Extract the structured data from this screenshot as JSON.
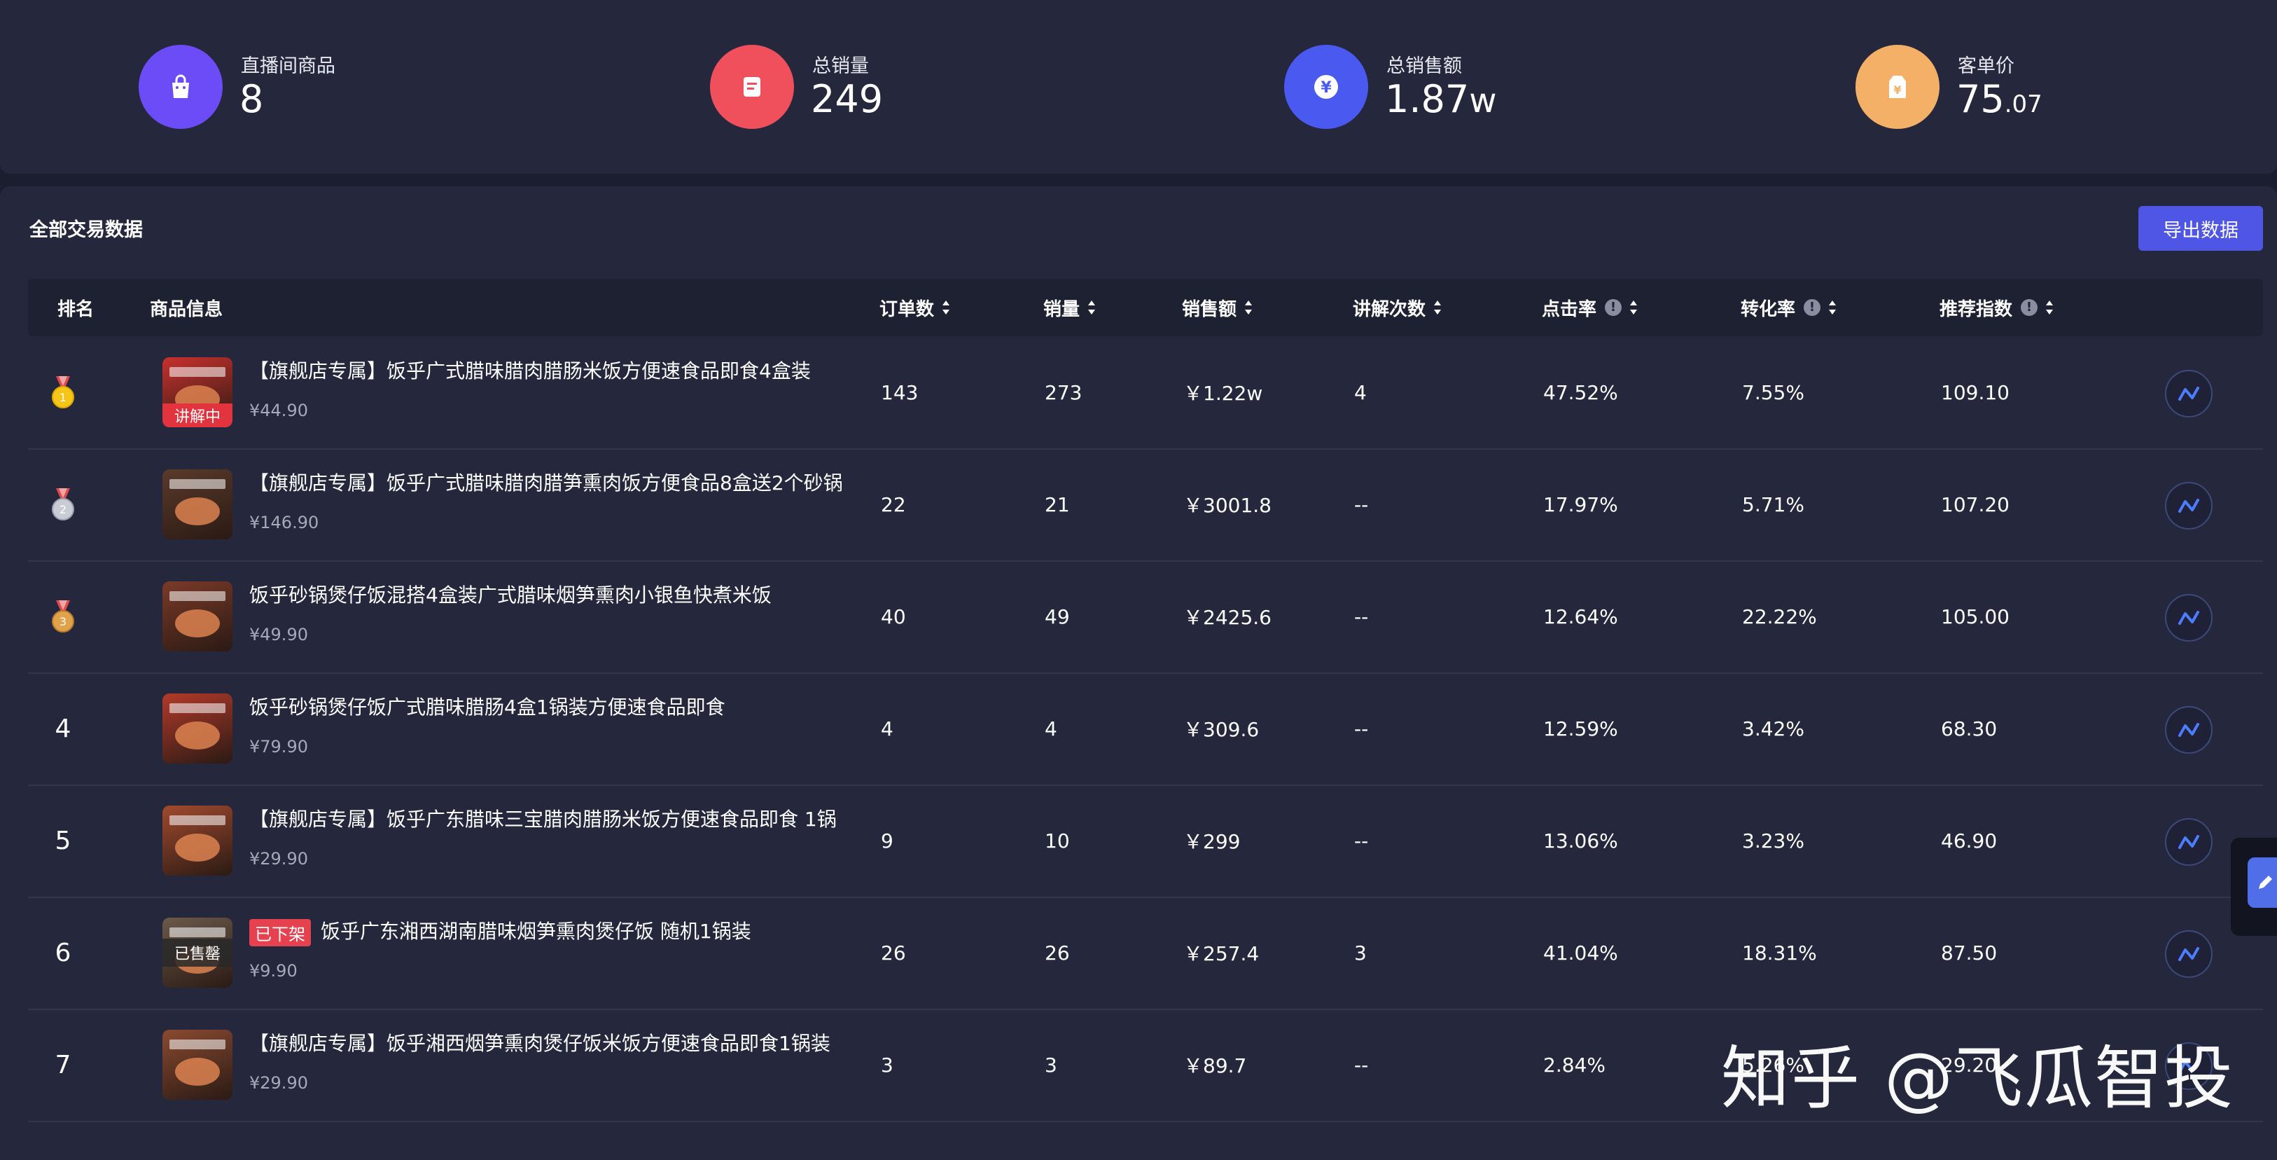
{
  "stats": [
    {
      "label": "直播间商品",
      "value": "8",
      "dec": "",
      "unit": "",
      "color": "#6b4cf6",
      "icon": "shopping-bag-icon"
    },
    {
      "label": "总销量",
      "value": "249",
      "dec": "",
      "unit": "",
      "color": "#f0505b",
      "icon": "receipt-icon"
    },
    {
      "label": "总销售额",
      "value": "1.87",
      "dec": "",
      "unit": "w",
      "color": "#4a5af0",
      "icon": "yen-coin-icon"
    },
    {
      "label": "客单价",
      "value": "75",
      "dec": ".07",
      "unit": "",
      "color": "#f5b067",
      "icon": "price-tag-icon"
    }
  ],
  "section": {
    "title": "全部交易数据",
    "export_label": "导出数据"
  },
  "columns": {
    "rank": "排名",
    "product": "商品信息",
    "orders": "订单数",
    "sales": "销量",
    "revenue": "销售额",
    "explain": "讲解次数",
    "ctr": "点击率",
    "cvr": "转化率",
    "score": "推荐指数"
  },
  "rows": [
    {
      "rank": "1",
      "medal": "gold",
      "name": "【旗舰店专属】饭乎广式腊味腊肉腊肠米饭方便速食品即食4盒装",
      "tag": "",
      "price": "¥44.90",
      "thumb_text": "讲解中",
      "orders": "143",
      "sales": "273",
      "revenue": "￥1.22w",
      "explain": "4",
      "ctr": "47.52%",
      "cvr": "7.55%",
      "score": "109.10"
    },
    {
      "rank": "2",
      "medal": "silver",
      "name": "【旗舰店专属】饭乎广式腊味腊肉腊笋熏肉饭方便食品8盒送2个砂锅",
      "tag": "",
      "price": "¥146.90",
      "thumb_text": "",
      "orders": "22",
      "sales": "21",
      "revenue": "￥3001.8",
      "explain": "--",
      "ctr": "17.97%",
      "cvr": "5.71%",
      "score": "107.20"
    },
    {
      "rank": "3",
      "medal": "bronze",
      "name": "饭乎砂锅煲仔饭混搭4盒装广式腊味烟笋熏肉小银鱼快煮米饭",
      "tag": "",
      "price": "¥49.90",
      "thumb_text": "",
      "orders": "40",
      "sales": "49",
      "revenue": "￥2425.6",
      "explain": "--",
      "ctr": "12.64%",
      "cvr": "22.22%",
      "score": "105.00"
    },
    {
      "rank": "4",
      "medal": "",
      "name": "饭乎砂锅煲仔饭广式腊味腊肠4盒1锅装方便速食品即食",
      "tag": "",
      "price": "¥79.90",
      "thumb_text": "",
      "orders": "4",
      "sales": "4",
      "revenue": "￥309.6",
      "explain": "--",
      "ctr": "12.59%",
      "cvr": "3.42%",
      "score": "68.30"
    },
    {
      "rank": "5",
      "medal": "",
      "name": "【旗舰店专属】饭乎广东腊味三宝腊肉腊肠米饭方便速食品即食 1锅",
      "tag": "",
      "price": "¥29.90",
      "thumb_text": "",
      "orders": "9",
      "sales": "10",
      "revenue": "￥299",
      "explain": "--",
      "ctr": "13.06%",
      "cvr": "3.23%",
      "score": "46.90"
    },
    {
      "rank": "6",
      "medal": "",
      "name": "饭乎广东湘西湖南腊味烟笋熏肉煲仔饭 随机1锅装",
      "tag": "已下架",
      "price": "¥9.90",
      "thumb_text": "已售罄",
      "orders": "26",
      "sales": "26",
      "revenue": "￥257.4",
      "explain": "3",
      "ctr": "41.04%",
      "cvr": "18.31%",
      "score": "87.50"
    },
    {
      "rank": "7",
      "medal": "",
      "name": "【旗舰店专属】饭乎湘西烟笋熏肉煲仔饭米饭方便速食品即食1锅装",
      "tag": "",
      "price": "¥29.90",
      "thumb_text": "",
      "orders": "3",
      "sales": "3",
      "revenue": "￥89.7",
      "explain": "--",
      "ctr": "2.84%",
      "cvr": "5.26%",
      "score": "29.20"
    }
  ],
  "watermark": "知乎 @飞瓜智投"
}
